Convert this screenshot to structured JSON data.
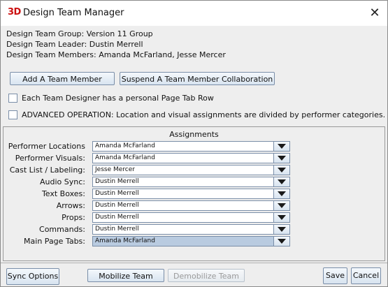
{
  "window": {
    "logo": "3D",
    "title": "Design Team Manager",
    "close_glyph": "✕"
  },
  "info": {
    "group": "Design Team Group: Version 11 Group",
    "leader": "Design Team Leader: Dustin Merrell",
    "members": "Design Team Members: Amanda McFarland, Jesse Mercer"
  },
  "actions": {
    "add_member": "Add A Team Member",
    "suspend_member": "Suspend A Team Member Collaboration"
  },
  "options": {
    "personal_tab": {
      "label": "Each Team Designer has a personal Page Tab Row",
      "checked": false
    },
    "advanced": {
      "label": "ADVANCED OPERATION: Location and visual assignments are divided by performer categories.",
      "checked": false
    }
  },
  "assignments": {
    "title": "Assignments",
    "rows": [
      {
        "label": "Performer Locations",
        "value": "Amanda McFarland"
      },
      {
        "label": "Performer Visuals:",
        "value": "Amanda McFarland"
      },
      {
        "label": "Cast List / Labeling:",
        "value": "Jesse Mercer"
      },
      {
        "label": "Audio Sync:",
        "value": "Dustin Merrell"
      },
      {
        "label": "Text Boxes:",
        "value": "Dustin Merrell"
      },
      {
        "label": "Arrows:",
        "value": "Dustin Merrell"
      },
      {
        "label": "Props:",
        "value": "Dustin Merrell"
      },
      {
        "label": "Commands:",
        "value": "Dustin Merrell"
      },
      {
        "label": "Main Page Tabs:",
        "value": "Amanda McFarland"
      }
    ]
  },
  "footer": {
    "sync_options": "Sync Options",
    "mobilize": "Mobilize Team",
    "demobilize": "Demobilize Team",
    "save": "Save",
    "cancel": "Cancel"
  }
}
